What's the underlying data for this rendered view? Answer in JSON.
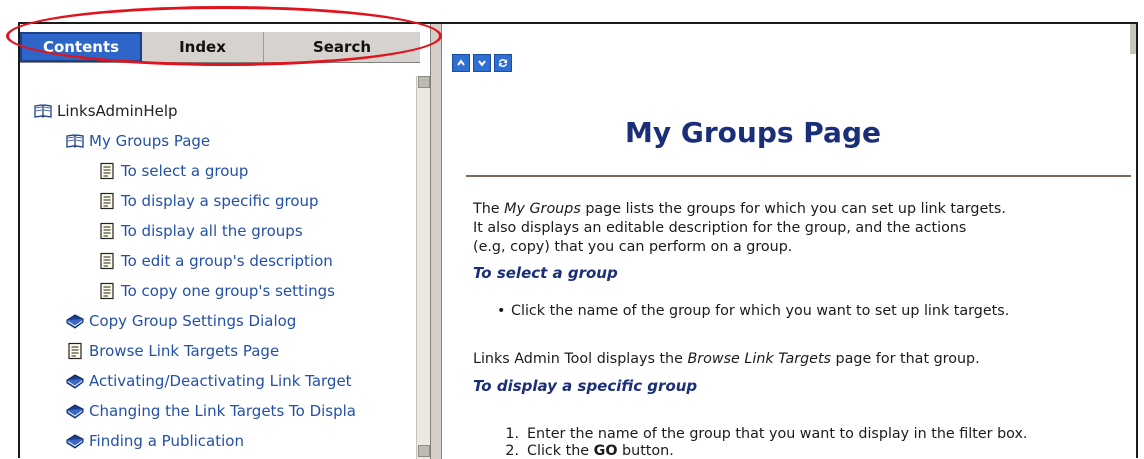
{
  "tabs": {
    "contents": "Contents",
    "index": "Index",
    "search": "Search"
  },
  "tree": {
    "root": "LinksAdminHelp",
    "items": [
      {
        "label": "My Groups Page",
        "icon": "open-book-icon"
      },
      {
        "label": "To select a group",
        "icon": "page-icon"
      },
      {
        "label": "To display a specific group",
        "icon": "page-icon"
      },
      {
        "label": "To display all the groups",
        "icon": "page-icon"
      },
      {
        "label": "To edit a group's description",
        "icon": "page-icon"
      },
      {
        "label": "To copy one group's settings",
        "icon": "page-icon"
      },
      {
        "label": "Copy Group Settings Dialog",
        "icon": "closed-book-icon"
      },
      {
        "label": "Browse Link Targets Page",
        "icon": "page-icon"
      },
      {
        "label": "Activating/Deactivating Link Target",
        "icon": "closed-book-icon"
      },
      {
        "label": "Changing the Link Targets To Displa",
        "icon": "closed-book-icon"
      },
      {
        "label": "Finding a Publication",
        "icon": "closed-book-icon"
      }
    ]
  },
  "nav": {
    "up": "^",
    "down": "v",
    "sync": "⇄"
  },
  "article": {
    "title": "My Groups Page",
    "intro_line1_pre": "The ",
    "intro_line1_em": "My Groups",
    "intro_line1_post": " page lists the groups for which you can set up link targets.",
    "intro_line2": "It also displays an editable description for the group, and the actions",
    "intro_line3": "(e.g, copy) that you can perform on a group.",
    "h_select": "To select a group",
    "bullet_select": "Click the name of the group for which you want to set up link targets.",
    "browse_pre": "Links Admin Tool displays the ",
    "browse_em": "Browse Link Targets",
    "browse_post": " page for that group.",
    "h_display": "To display a specific group",
    "step1": "Enter the name of the group that you want to display in the filter box.",
    "step2_pre": "Click the ",
    "step2_bold": "GO",
    "step2_post": " button.",
    "n1": "1.",
    "n2": "2."
  },
  "colors": {
    "active_tab": "#2e65c9",
    "link": "#2450a8",
    "title": "#1a2f78",
    "highlight": "#e0141e"
  }
}
